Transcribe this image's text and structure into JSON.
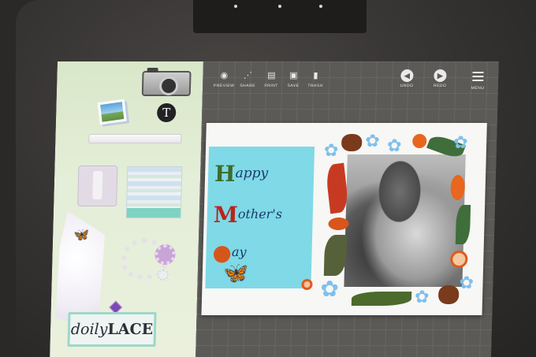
{
  "toolbar": {
    "preview_label": "PREVIEW",
    "share_label": "SHARE",
    "print_label": "PRINT",
    "save_label": "SAVE",
    "trash_label": "TRASH",
    "undo_label": "UNDO",
    "redo_label": "REDO",
    "menu_label": "MENU"
  },
  "sidebar": {
    "text_tool_glyph": "T",
    "pack_label_italic": "doily",
    "pack_label_caps": "LACE"
  },
  "card": {
    "line1_letter": "H",
    "line1_text": "appy",
    "line2_letter": "M",
    "line2_text": "other's",
    "line3_text": "ay"
  },
  "icons": {
    "preview": "eye-icon",
    "share": "share-icon",
    "print": "printer-icon",
    "save": "save-icon",
    "trash": "trash-icon",
    "undo": "undo-icon",
    "redo": "redo-icon",
    "menu": "menu-icon"
  },
  "colors": {
    "workspace": "#5b5a57",
    "sidebar": "#e4eed8",
    "card_background": "#7fd9e6",
    "pack_border": "#9fd7c8"
  }
}
